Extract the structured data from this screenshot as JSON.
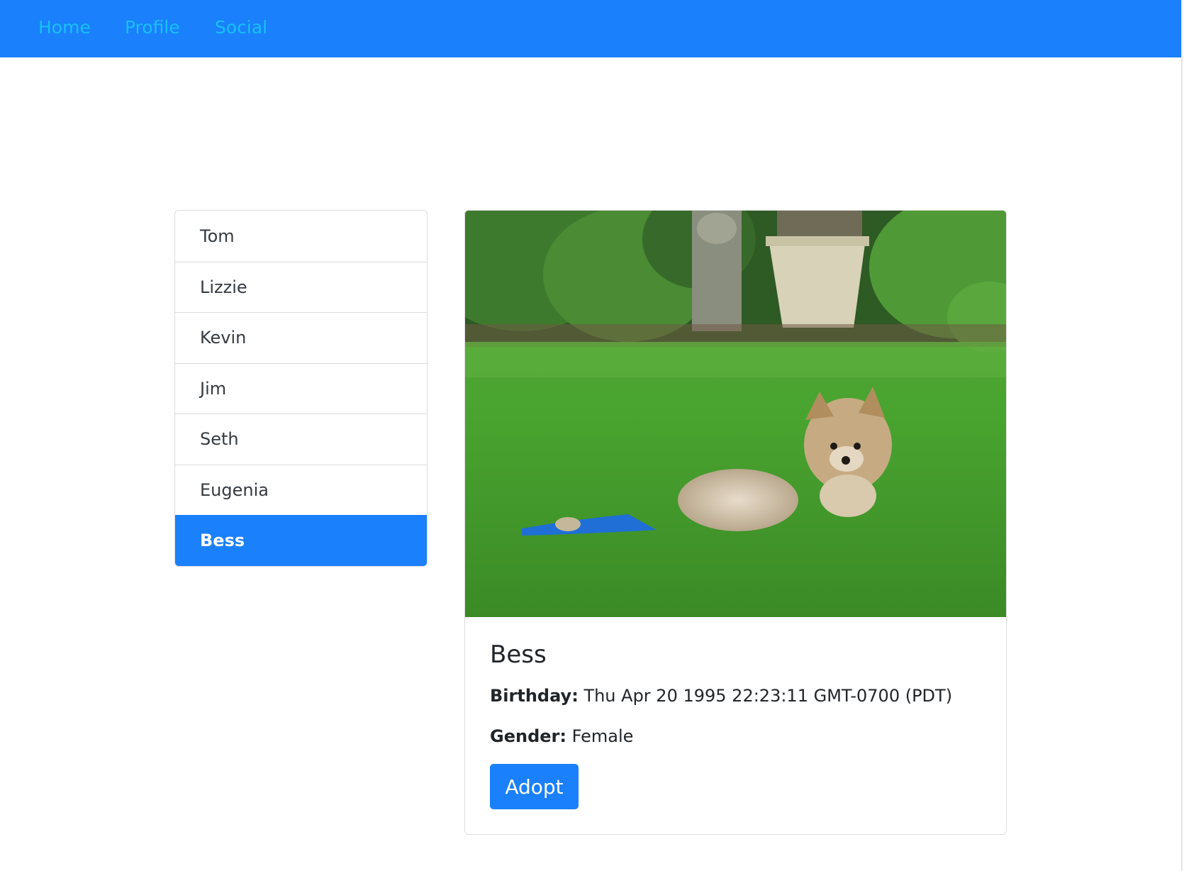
{
  "nav": {
    "links": [
      "Home",
      "Profile",
      "Social"
    ]
  },
  "pet_list": {
    "items": [
      "Tom",
      "Lizzie",
      "Kevin",
      "Jim",
      "Seth",
      "Eugenia",
      "Bess"
    ],
    "selected": "Bess"
  },
  "card": {
    "name": "Bess",
    "birthday_label": "Birthday:",
    "birthday_value": "Thu Apr 20 1995 22:23:11 GMT-0700 (PDT)",
    "gender_label": "Gender:",
    "gender_value": "Female",
    "adopt_label": "Adopt"
  },
  "colors": {
    "primary": "#1a80fb",
    "nav_link": "#17c0f5"
  }
}
